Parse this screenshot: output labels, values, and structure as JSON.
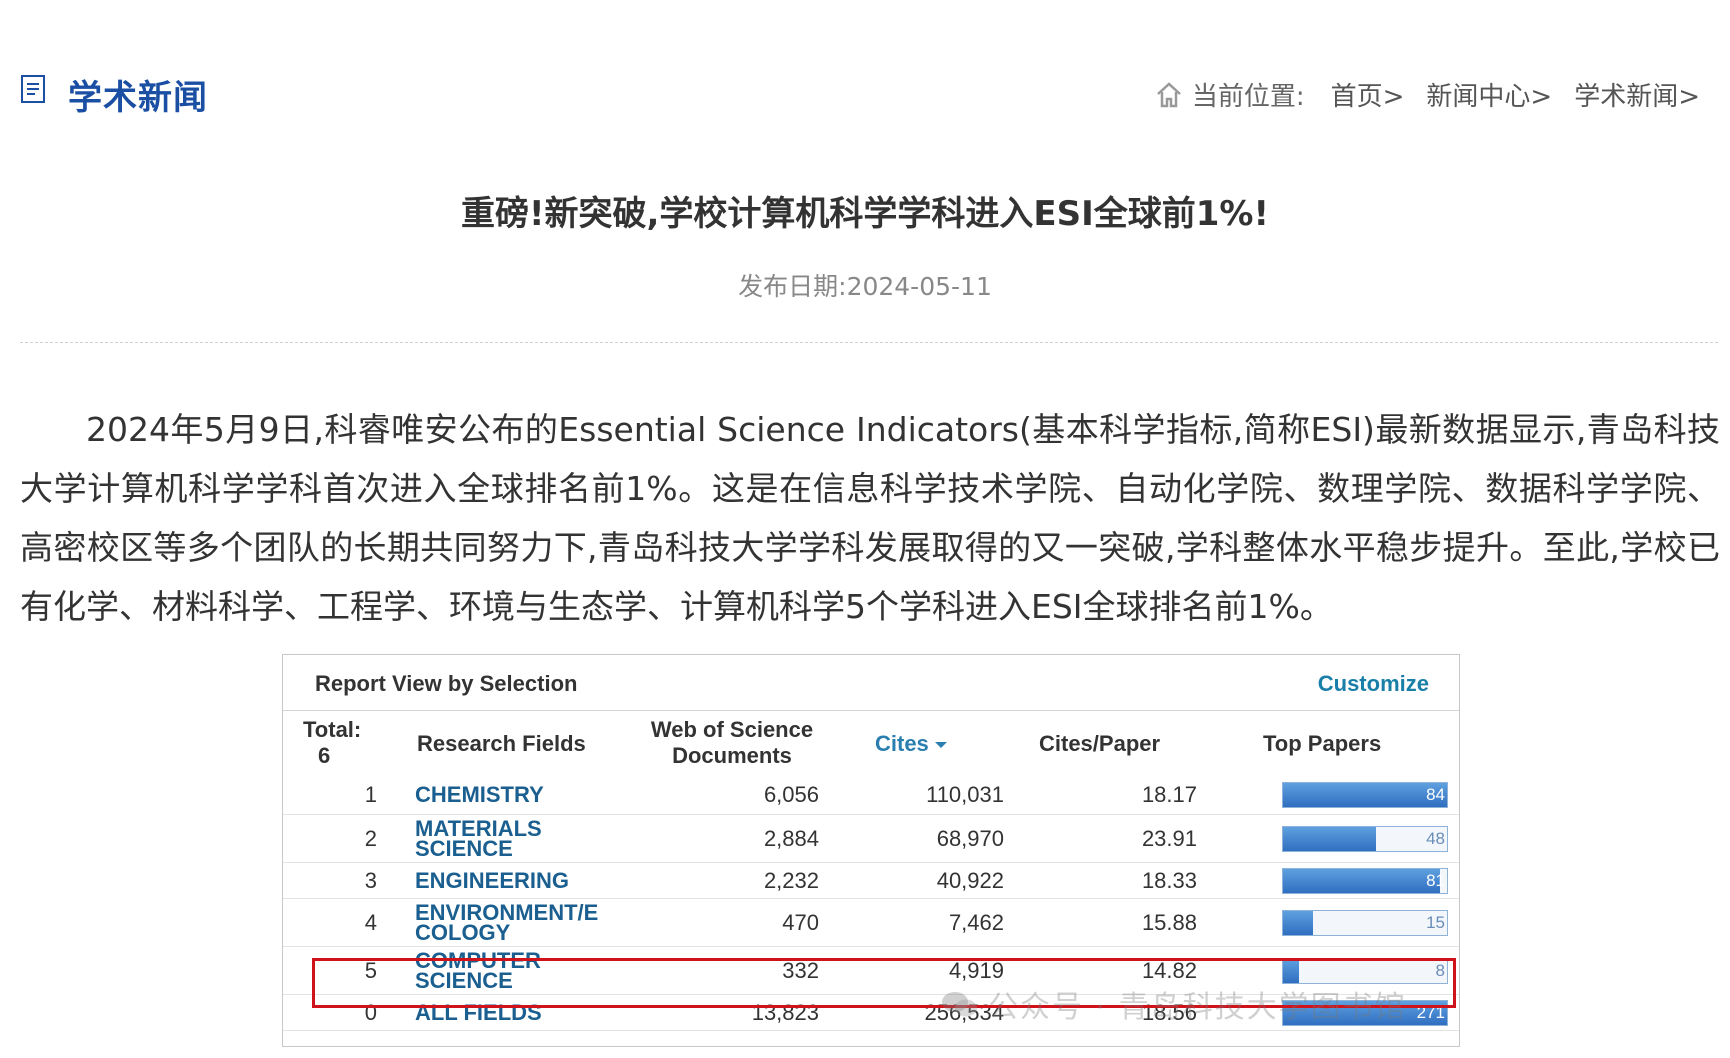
{
  "header": {
    "section_title": "学术新闻",
    "breadcrumb": {
      "label": "当前位置:",
      "items": [
        "首页>",
        "新闻中心>",
        "学术新闻>"
      ]
    }
  },
  "article": {
    "title": "重磅!新突破,学校计算机科学学科进入ESI全球前1%!",
    "date_label": "发布日期:",
    "date": "2024-05-11",
    "body": "2024年5月9日,科睿唯安公布的Essential Science Indicators(基本科学指标,简称ESI)最新数据显示,青岛科技大学计算机科学学科首次进入全球排名前1%。这是在信息科学技术学院、自动化学院、数理学院、数据科学学院、高密校区等多个团队的长期共同努力下,青岛科技大学学科发展取得的又一突破,学科整体水平稳步提升。至此,学校已有化学、材料科学、工程学、环境与生态学、计算机科学5个学科进入ESI全球排名前1%。"
  },
  "esi_table": {
    "report_title": "Report View by Selection",
    "customize_label": "Customize",
    "headers": {
      "total_label": "Total:",
      "total_value": "6",
      "fields": "Research Fields",
      "docs_line1": "Web of Science",
      "docs_line2": "Documents",
      "cites": "Cites",
      "cites_per_paper": "Cites/Paper",
      "top_papers": "Top Papers"
    },
    "rows": [
      {
        "rank": "1",
        "field1": "CHEMISTRY",
        "field2": "",
        "docs": "6,056",
        "cites": "110,031",
        "cpp": "18.17",
        "top": "84",
        "top_fraction": 1.0
      },
      {
        "rank": "2",
        "field1": "MATERIALS",
        "field2": "SCIENCE",
        "docs": "2,884",
        "cites": "68,970",
        "cpp": "23.91",
        "top": "48",
        "top_fraction": 0.57
      },
      {
        "rank": "3",
        "field1": "ENGINEERING",
        "field2": "",
        "docs": "2,232",
        "cites": "40,922",
        "cpp": "18.33",
        "top": "81",
        "top_fraction": 0.96
      },
      {
        "rank": "4",
        "field1": "ENVIRONMENT/E",
        "field2": "COLOGY",
        "docs": "470",
        "cites": "7,462",
        "cpp": "15.88",
        "top": "15",
        "top_fraction": 0.18
      },
      {
        "rank": "5",
        "field1": "COMPUTER",
        "field2": "SCIENCE",
        "docs": "332",
        "cites": "4,919",
        "cpp": "14.82",
        "top": "8",
        "top_fraction": 0.095
      },
      {
        "rank": "0",
        "field1": "ALL FIELDS",
        "field2": "",
        "docs": "13,823",
        "cites": "256,534",
        "cpp": "18.56",
        "top": "271",
        "top_fraction": 1.0
      }
    ]
  },
  "watermark": "公众号 · 青岛科技大学图书馆"
}
